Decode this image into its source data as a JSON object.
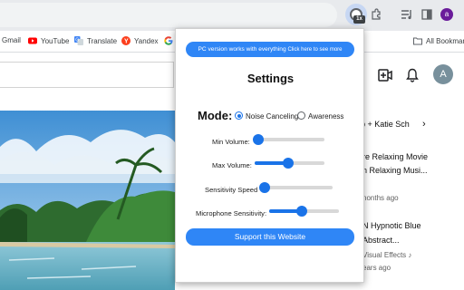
{
  "bookmarks": {
    "items": [
      {
        "label": "Gmail",
        "icon": "gmail-icon"
      },
      {
        "label": "YouTube",
        "icon": "youtube-icon"
      },
      {
        "label": "Translate",
        "icon": "translate-icon"
      },
      {
        "label": "Yandex",
        "icon": "yandex-icon"
      },
      {
        "label": "",
        "icon": "google-icon"
      }
    ],
    "all_bookmarks": "All Bookmark"
  },
  "toolbar": {
    "extension_badge": "1x",
    "profile_initial": "a"
  },
  "youtube": {
    "avatar_initial": "A",
    "chip_text": "b + Katie Sch",
    "recommendations": [
      {
        "title1": "re Relaxing Movie",
        "title2": "n Relaxing Musi...",
        "meta": "nonths ago"
      },
      {
        "title1": "N Hypnotic Blue",
        "title2": "Abstract...",
        "meta1": "Visual Effects ♪",
        "meta2": "ears ago"
      }
    ]
  },
  "popup": {
    "promo_main": "PC version works with everything",
    "promo_small": "Click here to see more",
    "title": "Settings",
    "mode_label": "Mode:",
    "mode_options": [
      {
        "label": "Noise Canceling",
        "selected": true
      },
      {
        "label": "Awareness",
        "selected": false
      }
    ],
    "sliders": [
      {
        "label": "Min Volume:",
        "value": 0.05
      },
      {
        "label": "Max Volume:",
        "value": 0.48
      },
      {
        "label": "Sensitivity Speed",
        "value": 0.03
      },
      {
        "label": "Microphone Sensitivity:",
        "value": 0.47
      }
    ],
    "support_label": "Support this Website"
  },
  "colors": {
    "accent": "#2f86f6",
    "slider_fill": "#1a73e8",
    "youtube_red": "#ff0000"
  }
}
